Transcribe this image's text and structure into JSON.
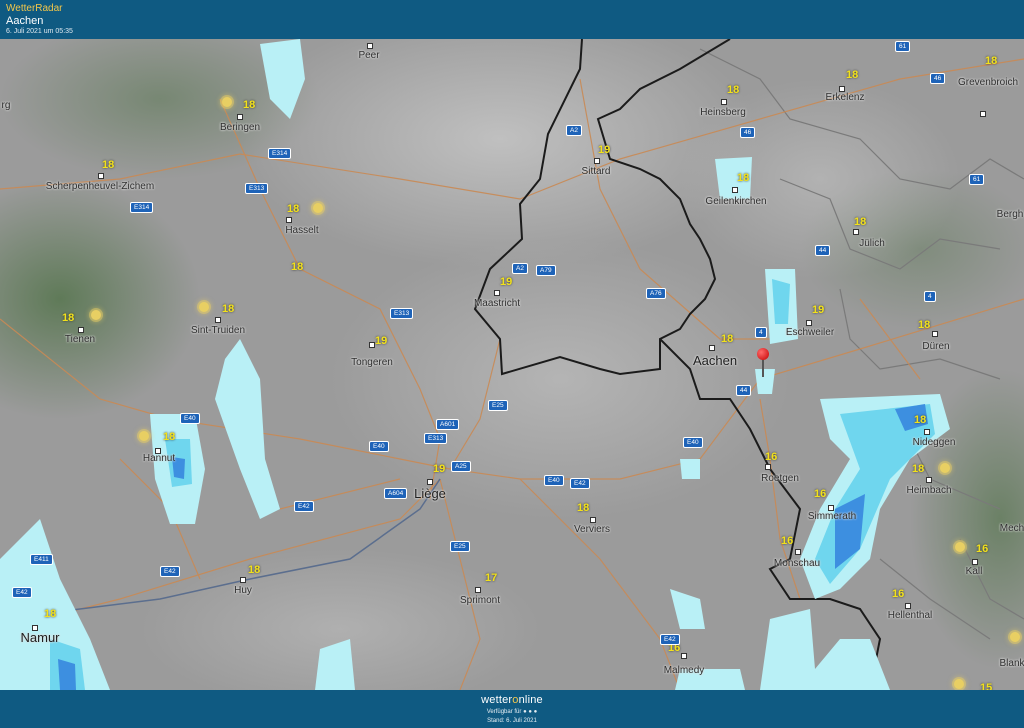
{
  "header": {
    "brand": "WetterRadar",
    "place": "Aachen",
    "timestamp": "6. Juli 2021 um 05:35"
  },
  "footer": {
    "logo_left": "wetter",
    "logo_o": "o",
    "logo_right": "nline",
    "availability": "Verfügbar für",
    "status": "Stand: 6. Juli 2021"
  },
  "map": {
    "colors": {
      "terrain": "#9a9a9a",
      "radar_light": "#b9f0f6",
      "radar_mid": "#6fd6ee",
      "radar_strong": "#3d8fe0",
      "border": "#1b1b1b",
      "roads": "#c98a55",
      "river": "#5b6e8e",
      "marker": "#e31414"
    },
    "marker": "map-pin-icon",
    "cities": [
      {
        "name": "Peer"
      },
      {
        "name": "Beringen"
      },
      {
        "name": "Scherpenheuvel-Zichem"
      },
      {
        "name": "Hasselt"
      },
      {
        "name": "Tienen"
      },
      {
        "name": "Sint-Truiden"
      },
      {
        "name": "Tongeren"
      },
      {
        "name": "Maastricht"
      },
      {
        "name": "Sittard"
      },
      {
        "name": "Heinsberg"
      },
      {
        "name": "Erkelenz"
      },
      {
        "name": "Grevenbroich"
      },
      {
        "name": "Geilenkirchen"
      },
      {
        "name": "Jülich"
      },
      {
        "name": "Eschweiler"
      },
      {
        "name": "Düren"
      },
      {
        "name": "Aachen"
      },
      {
        "name": "Hannut"
      },
      {
        "name": "Liège"
      },
      {
        "name": "Huy"
      },
      {
        "name": "Namur"
      },
      {
        "name": "Verviers"
      },
      {
        "name": "Sprimont"
      },
      {
        "name": "Roetgen"
      },
      {
        "name": "Nideggen"
      },
      {
        "name": "Heimbach"
      },
      {
        "name": "Simmerath"
      },
      {
        "name": "Monschau"
      },
      {
        "name": "Kall"
      },
      {
        "name": "Hellenthal"
      },
      {
        "name": "Malmedy"
      },
      {
        "name": "Bergh"
      },
      {
        "name": "Mech"
      },
      {
        "name": "Blank"
      },
      {
        "name": "rg"
      }
    ],
    "temperatures": [
      "18",
      "18",
      "18",
      "18",
      "18",
      "19",
      "19",
      "19",
      "18",
      "18",
      "18",
      "18",
      "18",
      "19",
      "18",
      "18",
      "18",
      "18",
      "19",
      "18",
      "18",
      "18",
      "17",
      "16",
      "18",
      "18",
      "16",
      "16",
      "16",
      "16",
      "16",
      "15"
    ],
    "roads": [
      "E314",
      "E313",
      "E314",
      "E313",
      "A2",
      "A2",
      "A79",
      "A76",
      "46",
      "46",
      "61",
      "61",
      "44",
      "4",
      "4",
      "44",
      "E40",
      "E40",
      "E40",
      "E40",
      "E42",
      "E42",
      "E42",
      "E42",
      "A601",
      "E313",
      "A25",
      "A604",
      "E25",
      "E25",
      "E411",
      "E42"
    ]
  }
}
